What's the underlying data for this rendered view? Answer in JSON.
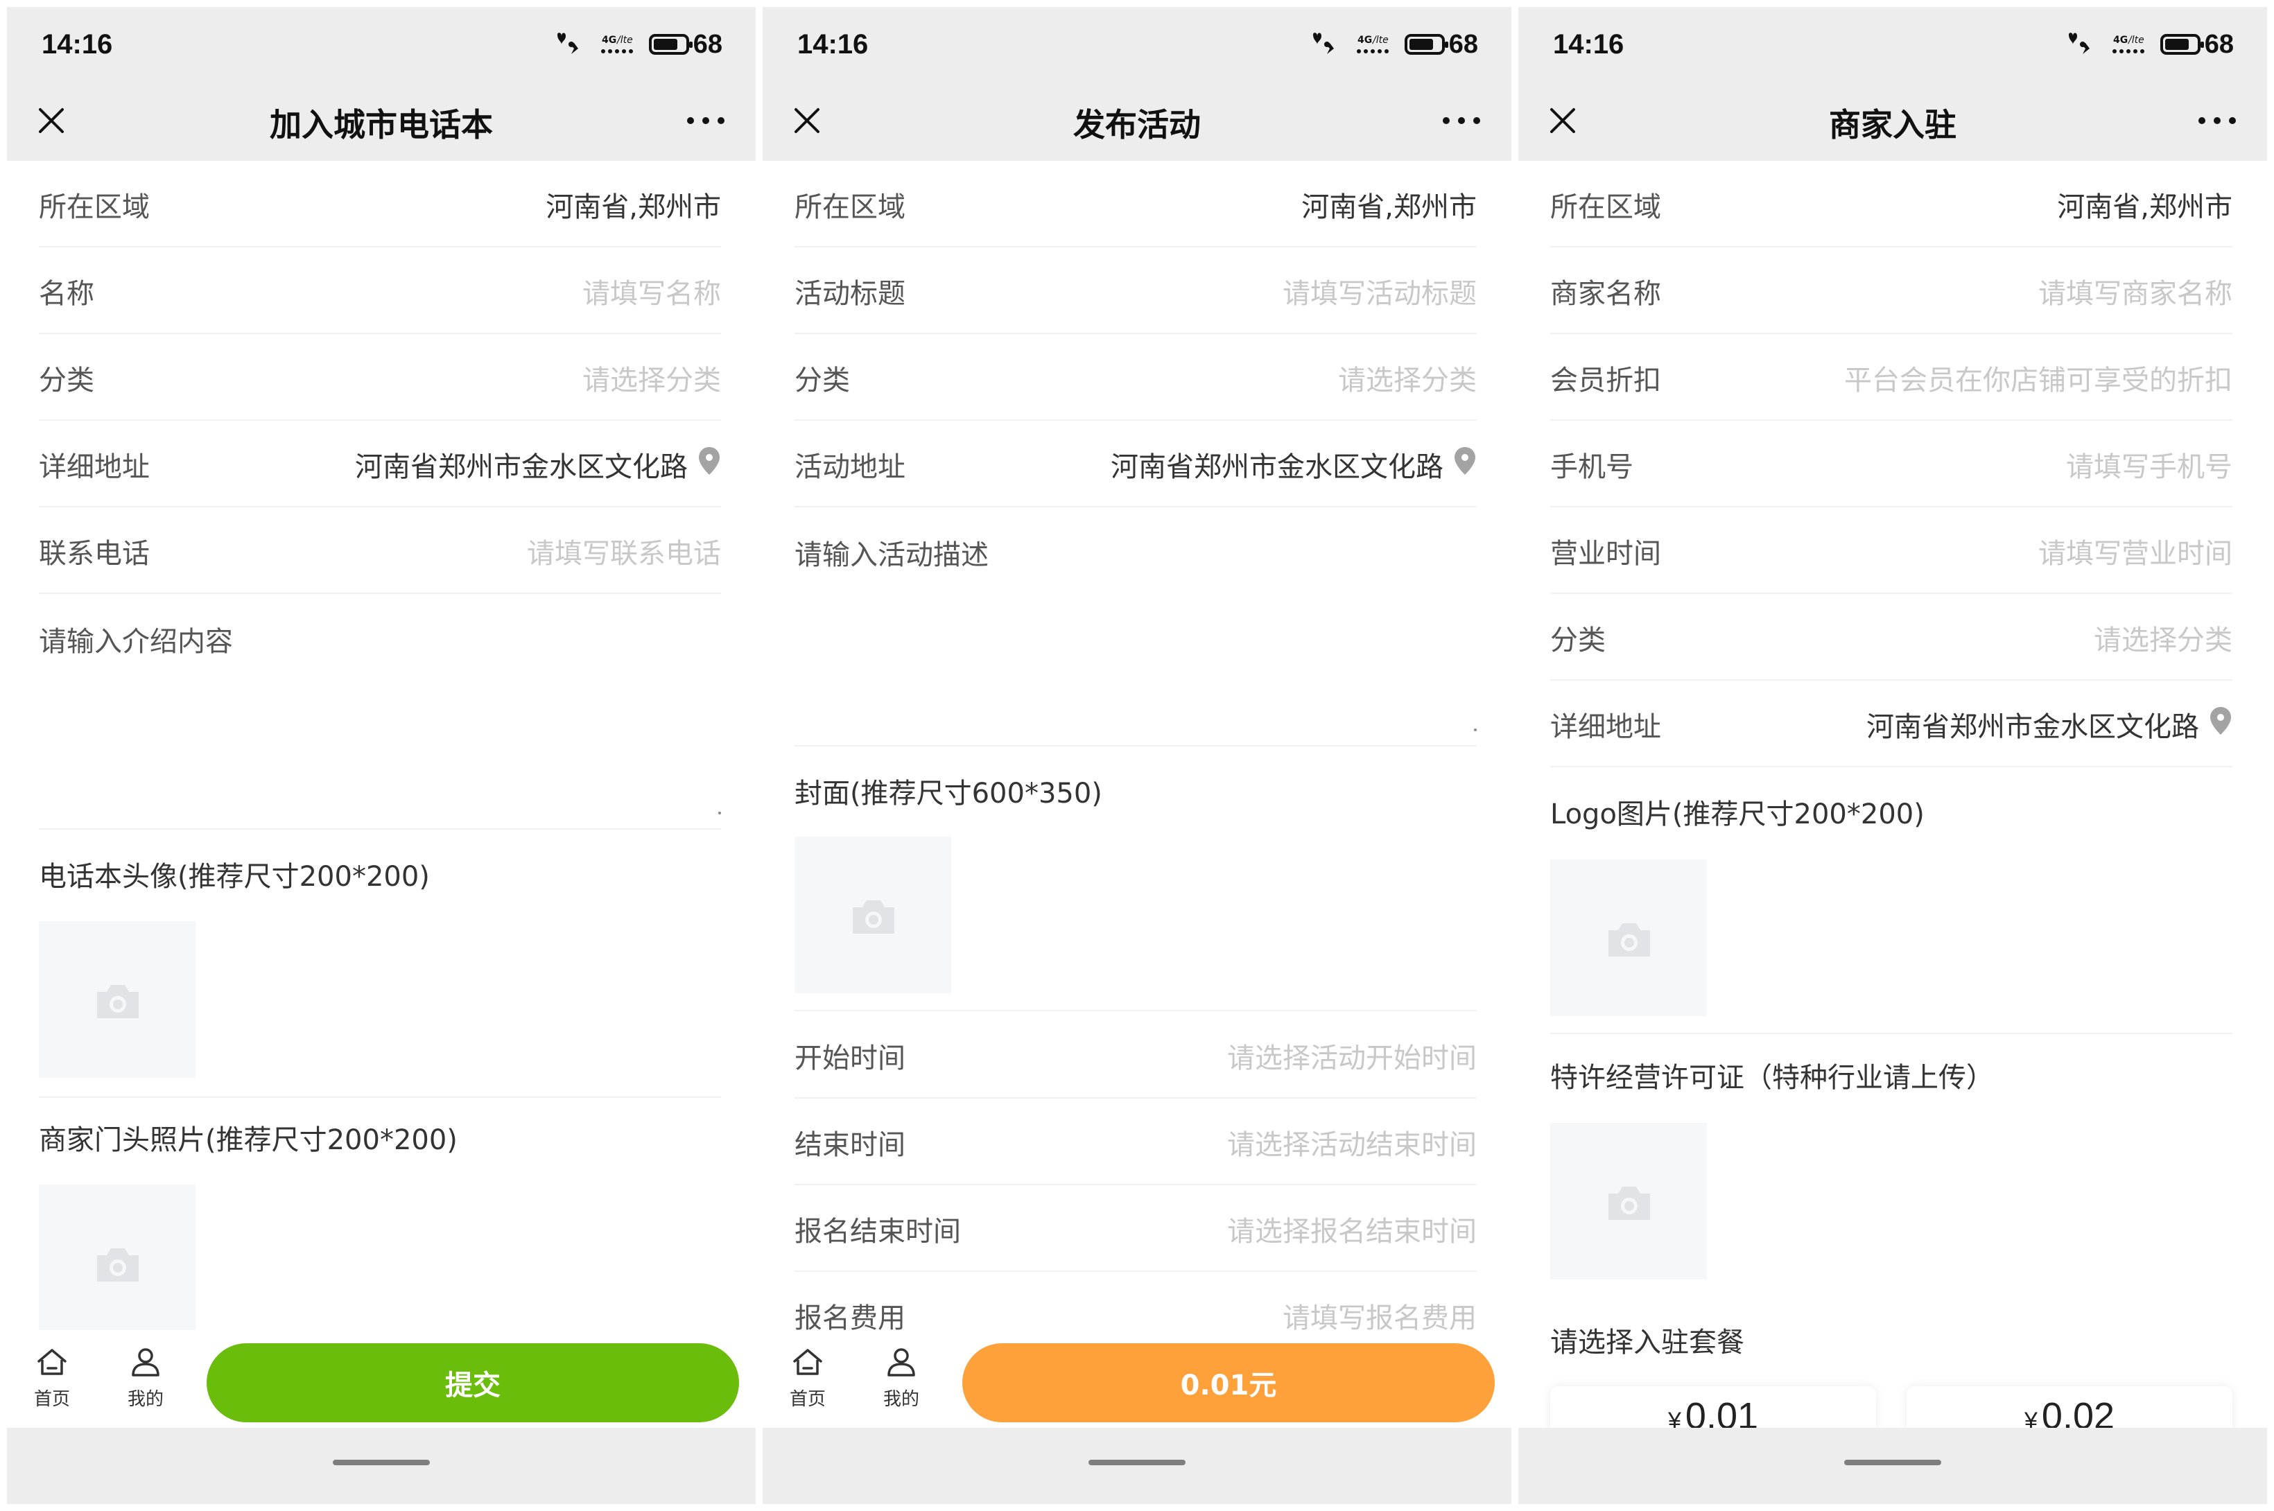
{
  "status": {
    "time": "14:16",
    "battery": "68"
  },
  "colors": {
    "green": "#6abd0b",
    "orange": "#ffa13b",
    "background": "#ededed"
  },
  "tabbar": {
    "home": "首页",
    "mine": "我的"
  },
  "screens": [
    {
      "title": "加入城市电话本",
      "rows": [
        {
          "label": "所在区域",
          "value": "河南省,郑州市"
        },
        {
          "label": "名称",
          "placeholder": "请填写名称"
        },
        {
          "label": "分类",
          "placeholder": "请选择分类"
        },
        {
          "label": "详细地址",
          "value": "河南省郑州市金水区文化路"
        },
        {
          "label": "联系电话",
          "placeholder": "请填写联系电话"
        }
      ],
      "textarea_placeholder": "请输入介绍内容",
      "uploads": [
        {
          "label": "电话本头像(推荐尺寸200*200)"
        },
        {
          "label": "商家门头照片(推荐尺寸200*200)"
        }
      ],
      "button": "提交"
    },
    {
      "title": "发布活动",
      "rows": [
        {
          "label": "所在区域",
          "value": "河南省,郑州市"
        },
        {
          "label": "活动标题",
          "placeholder": "请填写活动标题"
        },
        {
          "label": "分类",
          "placeholder": "请选择分类"
        },
        {
          "label": "活动地址",
          "value": "河南省郑州市金水区文化路"
        }
      ],
      "textarea_placeholder": "请输入活动描述",
      "uploads": [
        {
          "label": "封面(推荐尺寸600*350)"
        }
      ],
      "rows2": [
        {
          "label": "开始时间",
          "placeholder": "请选择活动开始时间"
        },
        {
          "label": "结束时间",
          "placeholder": "请选择活动结束时间"
        },
        {
          "label": "报名结束时间",
          "placeholder": "请选择报名结束时间"
        },
        {
          "label": "报名费用",
          "placeholder": "请填写报名费用"
        }
      ],
      "button": "0.01元"
    },
    {
      "title": "商家入驻",
      "rows": [
        {
          "label": "所在区域",
          "value": "河南省,郑州市"
        },
        {
          "label": "商家名称",
          "placeholder": "请填写商家名称"
        },
        {
          "label": "会员折扣",
          "placeholder": "平台会员在你店铺可享受的折扣"
        },
        {
          "label": "手机号",
          "placeholder": "请填写手机号"
        },
        {
          "label": "营业时间",
          "placeholder": "请填写营业时间"
        },
        {
          "label": "分类",
          "placeholder": "请选择分类"
        },
        {
          "label": "详细地址",
          "value": "河南省郑州市金水区文化路"
        }
      ],
      "uploads": [
        {
          "label": "Logo图片(推荐尺寸200*200)"
        },
        {
          "label": "特许经营许可证（特种行业请上传）"
        }
      ],
      "package_title": "请选择入驻套餐",
      "packages": [
        {
          "currency": "¥",
          "price": "0.01"
        },
        {
          "currency": "¥",
          "price": "0.02"
        }
      ]
    }
  ]
}
